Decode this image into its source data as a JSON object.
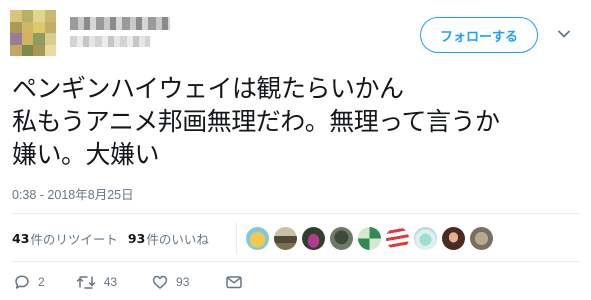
{
  "header": {
    "follow_label": "フォローする"
  },
  "tweet": {
    "lines": [
      "ペンギンハイウェイは観たらいかん",
      "私もうアニメ邦画無理だわ。無理って言うか",
      "嫌い。大嫌い"
    ],
    "timestamp": "0:38 - 2018年8月25日"
  },
  "stats": {
    "retweets_count": "43",
    "retweets_label": "件のリツイート",
    "likes_count": "93",
    "likes_label": "件のいいね"
  },
  "actions": {
    "reply_count": "2",
    "retweet_count": "43",
    "like_count": "93"
  },
  "colors": {
    "accent": "#1da1f2",
    "secondary_text": "#657786",
    "divider": "#e6ecf0"
  },
  "icons": [
    "chevron-down-icon",
    "reply-icon",
    "retweet-icon",
    "like-icon",
    "message-icon"
  ]
}
